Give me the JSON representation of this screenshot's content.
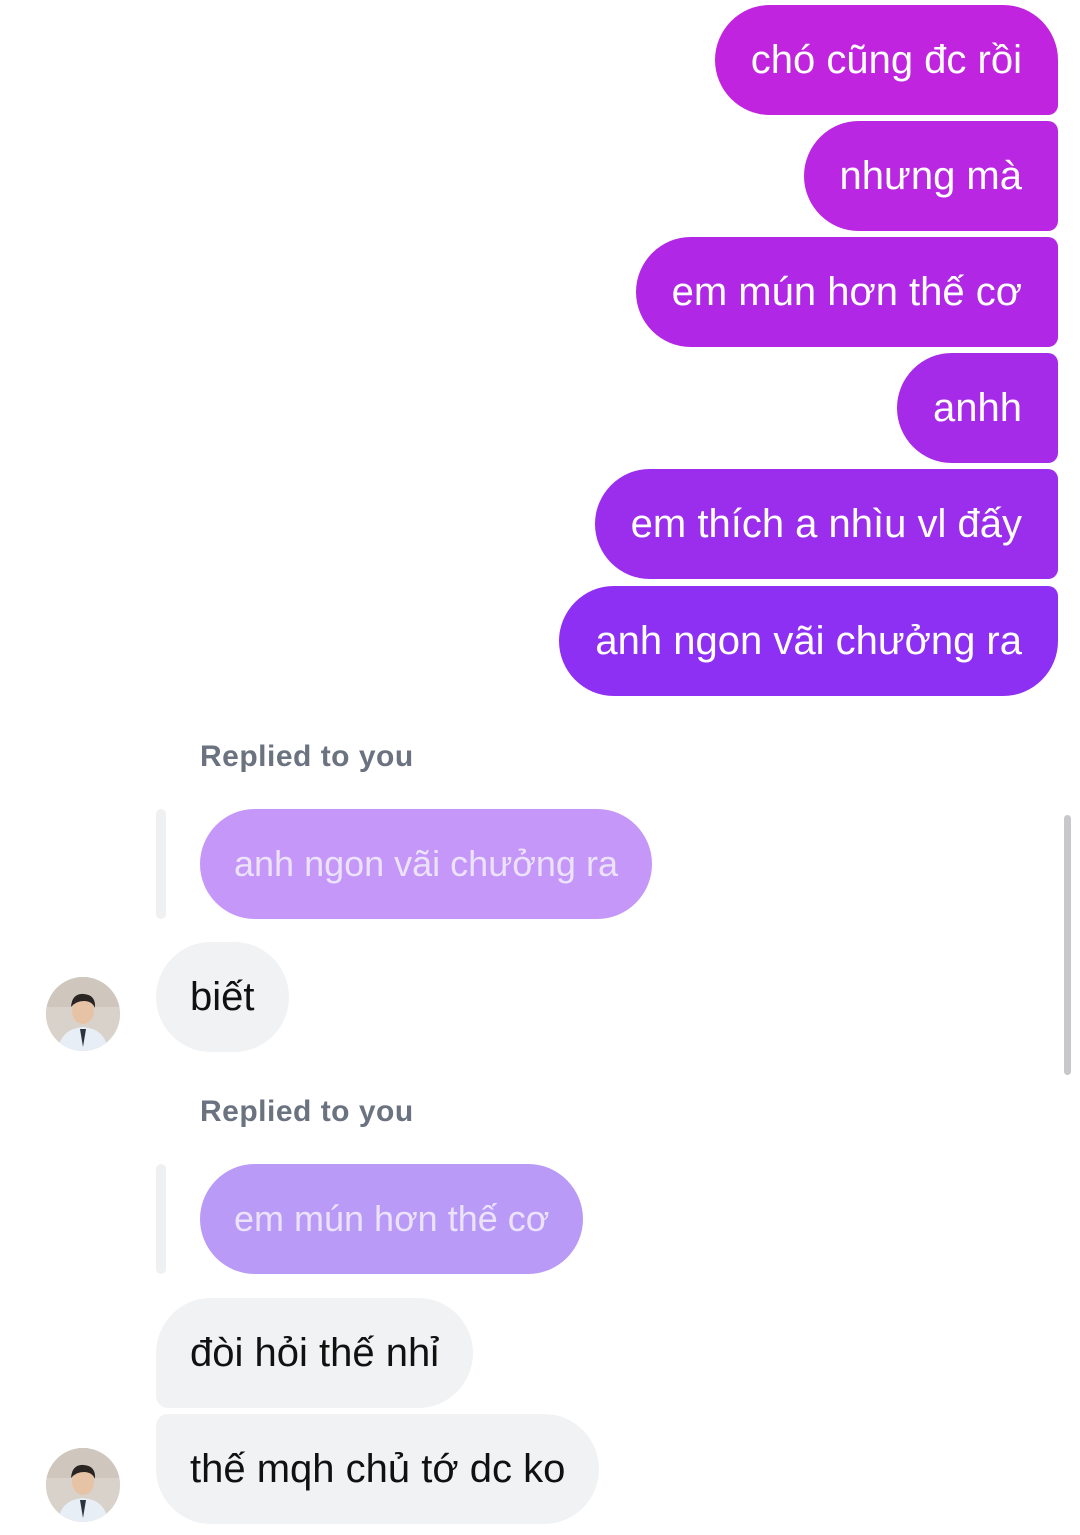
{
  "sent_messages": [
    {
      "text": "chó cũng đc rồi"
    },
    {
      "text": "nhưng mà"
    },
    {
      "text": "em mún hơn thế cơ"
    },
    {
      "text": "anhh"
    },
    {
      "text": "em thích a nhìu vl đấy"
    },
    {
      "text": "anh ngon vãi chưởng ra"
    }
  ],
  "reply_blocks": [
    {
      "label": "Replied to you",
      "quoted": "anh ngon vãi chưởng ra",
      "messages": [
        "biết"
      ]
    },
    {
      "label": "Replied to you",
      "quoted": "em mún hơn thế cơ",
      "messages": [
        "đòi hỏi thế nhỉ",
        "thế mqh chủ tớ dc ko"
      ]
    }
  ],
  "colors": {
    "sent_gradient_top": "#c225dc",
    "sent_gradient_bottom": "#8a2ff5",
    "quoted_bubble": "#c497f8",
    "quoted_bubble_2": "#b99af7",
    "received_bubble": "#f1f2f4"
  },
  "icons": {
    "avatar": "contact-avatar-icon"
  }
}
